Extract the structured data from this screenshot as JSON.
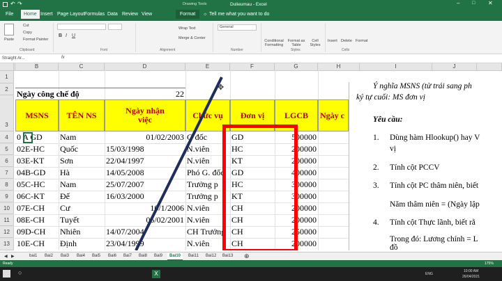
{
  "app": {
    "title": "Dulieumau  -  Excel",
    "drawing_tools": "Drawing Tools",
    "user_initial": "□"
  },
  "tabs": [
    {
      "label": "File"
    },
    {
      "label": "Home"
    },
    {
      "label": "Insert"
    },
    {
      "label": "Page Layout"
    },
    {
      "label": "Formulas"
    },
    {
      "label": "Data"
    },
    {
      "label": "Review"
    },
    {
      "label": "View"
    },
    {
      "label": "Format"
    }
  ],
  "tell_me": "Tell me what you want to do",
  "ribbon": {
    "cut": "Cut",
    "copy": "Copy",
    "format_painter": "Format Painter",
    "paste": "Paste",
    "wrap_text": "Wrap Text",
    "merge_center": "Merge & Center",
    "number_format": "General",
    "conditional": "Conditional Formatting",
    "format_as_table": "Format as Table",
    "cell_styles": "Cell Styles",
    "insert": "Insert",
    "delete": "Delete",
    "format": "Format",
    "groups": {
      "clipboard": "Clipboard",
      "font": "Font",
      "alignment": "Alignment",
      "number": "Number",
      "styles": "Styles",
      "cells": "Cells"
    }
  },
  "formula_bar": {
    "name_box": "Straight Ar...",
    "fx": "fx",
    "value": ""
  },
  "columns": [
    "A",
    "B",
    "C",
    "D",
    "E",
    "F",
    "G",
    "H",
    "I",
    "J"
  ],
  "rows": [
    "1",
    "2",
    "3",
    "4",
    "5",
    "6",
    "7",
    "8",
    "9",
    "10",
    "11",
    "12",
    "13"
  ],
  "title_row": {
    "label": "Ngày công chế độ",
    "value": "22"
  },
  "headers": [
    "MSNS",
    "TÊN NS",
    "Ngày nhận việc",
    "Chức vụ",
    "Đơn vị",
    "LGCB",
    "Ngày c"
  ],
  "table": [
    {
      "msns": "0 A GD",
      "ten": "Nam",
      "ngay": "01/02/2003",
      "chucvu": "G đốc",
      "donvi": "GD",
      "lgcb": "500000"
    },
    {
      "msns": "02E-HC",
      "ten": "Quốc",
      "ngay": "15/03/1998",
      "chucvu": "N.viên",
      "donvi": "HC",
      "lgcb": "200000"
    },
    {
      "msns": "03E-KT",
      "ten": "Sơn",
      "ngay": "22/04/1997",
      "chucvu": "N.viên",
      "donvi": "KT",
      "lgcb": "200000"
    },
    {
      "msns": "04B-GD",
      "ten": "Hà",
      "ngay": "14/05/2008",
      "chucvu": "Phó G. đốc",
      "donvi": "GD",
      "lgcb": "400000"
    },
    {
      "msns": "05C-HC",
      "ten": "Nam",
      "ngay": "25/07/2007",
      "chucvu": "Trưởng p",
      "donvi": "HC",
      "lgcb": "300000"
    },
    {
      "msns": "06C-KT",
      "ten": "Đế",
      "ngay": "16/03/2000",
      "chucvu": "Trưởng p",
      "donvi": "KT",
      "lgcb": "300000"
    },
    {
      "msns": "07E-CH",
      "ten": "Cư",
      "ngay": "10/1/2006",
      "chucvu": "N.viên",
      "donvi": "CH",
      "lgcb": "200000"
    },
    {
      "msns": "08E-CH",
      "ten": "Tuyết",
      "ngay": "05/02/2001",
      "chucvu": "N.viên",
      "donvi": "CH",
      "lgcb": "200000"
    },
    {
      "msns": "09D-CH",
      "ten": "Nhiên",
      "ngay": "14/07/2004",
      "chucvu": "CH Trưởng",
      "donvi": "CH",
      "lgcb": "250000"
    },
    {
      "msns": "10E-CH",
      "ten": "Định",
      "ngay": "23/04/1999",
      "chucvu": "N.viên",
      "donvi": "CH",
      "lgcb": "200000"
    }
  ],
  "panel": {
    "line1": "Ý nghĩa MSNS (từ trái sang ph",
    "line2": "ký tự cuối: MS đơn vị",
    "req": "Yêu cầu:",
    "items": [
      {
        "num": "1.",
        "text": "Dùng hàm Hlookup() hay V"
      },
      {
        "num": "",
        "text": "vị"
      },
      {
        "num": "2.",
        "text": "Tính cột PCCV"
      },
      {
        "num": "3.",
        "text": "Tính cột PC thâm niên, biết"
      },
      {
        "num": "",
        "text": "Năm thâm niên = (Ngày lập"
      },
      {
        "num": "4.",
        "text": "Tính cột Thực lãnh, biết  rằ"
      },
      {
        "num": "",
        "text": "Trong đó: Lương chính = L"
      },
      {
        "num": "",
        "text": "đồ"
      }
    ]
  },
  "sheet_tabs": [
    "bai1",
    "Bai2",
    "Bai3",
    "Bai4",
    "Bai5",
    "Bai6",
    "Bai7",
    "Bai8",
    "Bai9",
    "Bai10",
    "Bai11",
    "Bai12",
    "Bai13"
  ],
  "active_sheet": "Bai10",
  "status": {
    "ready": "Ready",
    "zoom": "175%"
  },
  "taskbar": {
    "time": "10:00 AM",
    "date": "26/04/2021",
    "lang": "ENG"
  },
  "colors": {
    "excel_green": "#217346",
    "header_fill": "#ffff00",
    "header_text": "#c00000",
    "highlight_box": "#ff0000",
    "line": "#1f2d5a"
  }
}
